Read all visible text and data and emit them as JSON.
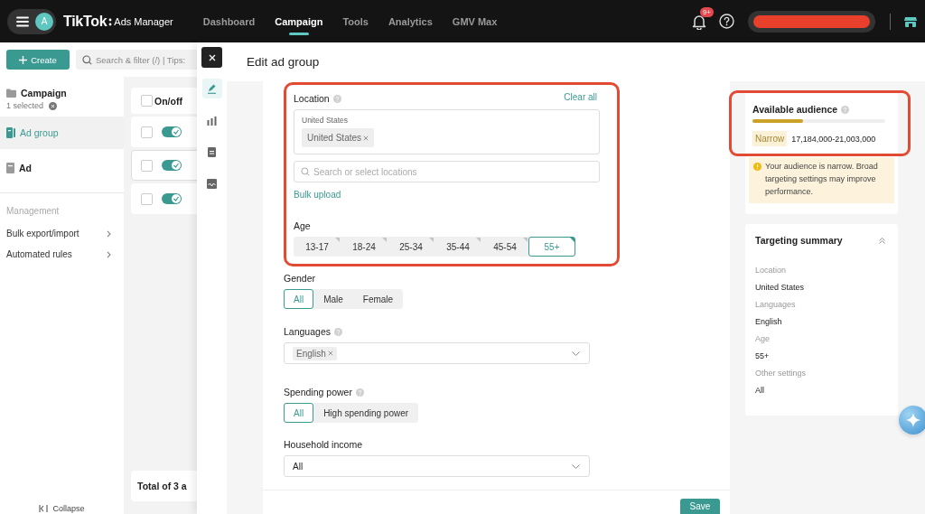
{
  "topbar": {
    "avatar": "A",
    "logo": "TikTok",
    "product": "Ads Manager",
    "nav": [
      {
        "label": "Dashboard",
        "selected": false
      },
      {
        "label": "Campaign",
        "selected": true
      },
      {
        "label": "Tools",
        "selected": false
      },
      {
        "label": "Analytics",
        "selected": false
      },
      {
        "label": "GMV Max",
        "selected": false
      }
    ],
    "notification_badge": "9+"
  },
  "toolbar": {
    "create": "Create",
    "search": {
      "placeholder": "Search & filter (/) | Tips:"
    }
  },
  "sidebar": {
    "items": [
      {
        "kind": "campaign",
        "label": "Campaign",
        "note": "1 selected",
        "selected": false
      },
      {
        "kind": "adgroup",
        "label": "Ad group",
        "selected": true
      },
      {
        "kind": "ad",
        "label": "Ad",
        "selected": false
      }
    ],
    "management": {
      "heading": "Management",
      "links": [
        "Bulk export/import",
        "Automated rules"
      ]
    },
    "collapse": "Collapse"
  },
  "table": {
    "header": "On/off",
    "header_checked": false,
    "rows": [
      {
        "checked": false,
        "on": true,
        "hovered": false
      },
      {
        "checked": false,
        "on": true,
        "hovered": true
      },
      {
        "checked": false,
        "on": true,
        "hovered": false
      }
    ],
    "footer": "Total of 3 a"
  },
  "drawer": {
    "title": "Edit ad group",
    "rail": [
      {
        "kind": "edit",
        "selected": true
      },
      {
        "kind": "chart",
        "selected": false
      },
      {
        "kind": "document",
        "selected": false
      },
      {
        "kind": "image",
        "selected": false
      }
    ]
  },
  "form": {
    "targeting": {
      "highlighted": true,
      "location": {
        "label": "Location",
        "clear": "Clear all",
        "group_label": "United States",
        "tags": [
          "United States"
        ],
        "search_placeholder": "Search or select locations",
        "bulk": "Bulk upload"
      },
      "age": {
        "label": "Age",
        "options": [
          {
            "label": "13-17",
            "selected": false
          },
          {
            "label": "18-24",
            "selected": false
          },
          {
            "label": "25-34",
            "selected": false
          },
          {
            "label": "35-44",
            "selected": false
          },
          {
            "label": "45-54",
            "selected": false
          },
          {
            "label": "55+",
            "selected": true
          }
        ]
      }
    },
    "gender": {
      "label": "Gender",
      "options": [
        {
          "label": "All",
          "selected": true
        },
        {
          "label": "Male",
          "selected": false
        },
        {
          "label": "Female",
          "selected": false
        }
      ]
    },
    "languages": {
      "label": "Languages",
      "tags": [
        "English"
      ]
    },
    "spending_power": {
      "label": "Spending power",
      "options": [
        {
          "label": "All",
          "selected": true
        },
        {
          "label": "High spending power",
          "selected": false
        }
      ]
    },
    "household_income": {
      "label": "Household income",
      "value": "All"
    },
    "save": "Save"
  },
  "audience": {
    "title": "Available audience",
    "highlighted": true,
    "level": 0.38,
    "breadth": "Narrow",
    "range": "17,184,000-21,003,000",
    "warning": "Your audience is narrow. Broad targeting settings may improve performance."
  },
  "summary": {
    "title": "Targeting summary",
    "expanded": true,
    "items": [
      {
        "label": "Location",
        "value": "United States"
      },
      {
        "label": "Languages",
        "value": "English"
      },
      {
        "label": "Age",
        "value": "55+"
      },
      {
        "label": "Other settings",
        "value": "All"
      }
    ]
  }
}
